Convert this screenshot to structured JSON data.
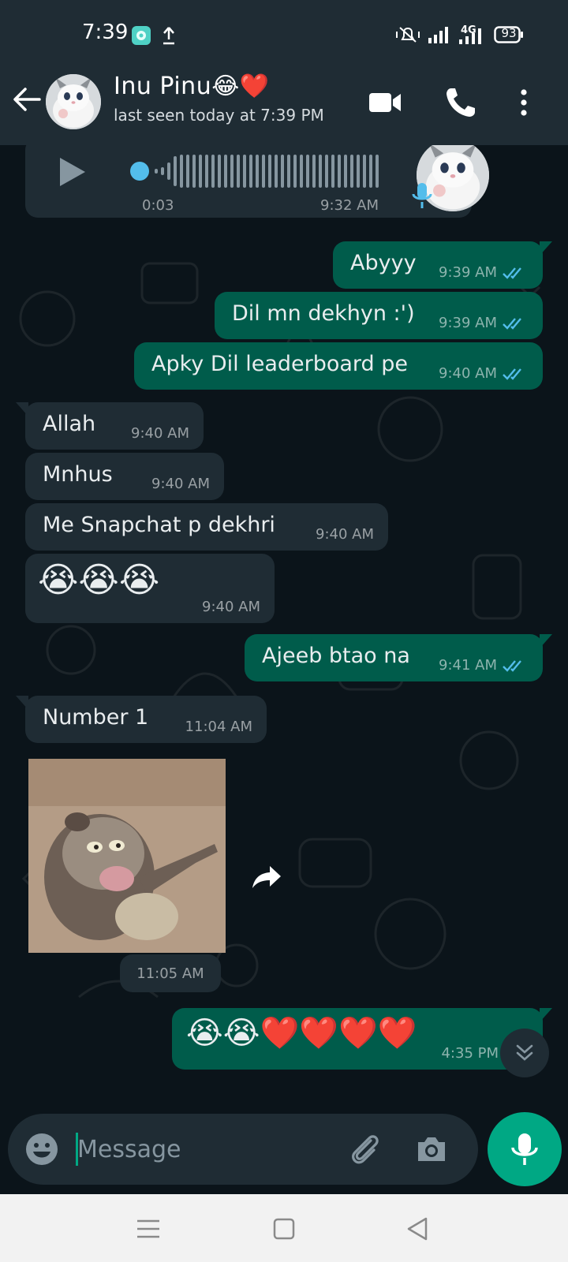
{
  "status_bar": {
    "time": "7:39",
    "battery": "93",
    "network": "4G",
    "icons": [
      "app-notification-icon",
      "upload-icon",
      "mute-icon",
      "signal-icon",
      "4g-signal-icon",
      "battery-icon"
    ]
  },
  "header": {
    "contact_name": "Inu Pinu😂❤️",
    "last_seen": "last seen today at 7:39 PM",
    "icons": [
      "back-arrow-icon",
      "video-call-icon",
      "phone-call-icon",
      "more-options-icon"
    ]
  },
  "messages": [
    {
      "type": "voice",
      "direction": "in",
      "duration": "0:03",
      "time": "9:32 AM"
    },
    {
      "type": "text",
      "direction": "out",
      "text": "Abyyy",
      "time": "9:39 AM",
      "status": "read"
    },
    {
      "type": "text",
      "direction": "out",
      "text": "Dil mn dekhyn :')",
      "time": "9:39 AM",
      "status": "read"
    },
    {
      "type": "text",
      "direction": "out",
      "text": "Apky Dil leaderboard pe",
      "time": "9:40 AM",
      "status": "read"
    },
    {
      "type": "text",
      "direction": "in",
      "text": "Allah",
      "time": "9:40 AM"
    },
    {
      "type": "text",
      "direction": "in",
      "text": "Mnhus",
      "time": "9:40 AM"
    },
    {
      "type": "text",
      "direction": "in",
      "text": "Me Snapchat p dekhri",
      "time": "9:40 AM"
    },
    {
      "type": "emoji",
      "direction": "in",
      "text": "😭😭😭",
      "time": "9:40 AM"
    },
    {
      "type": "text",
      "direction": "out",
      "text": "Ajeeb btao na",
      "time": "9:41 AM",
      "status": "read"
    },
    {
      "type": "text",
      "direction": "in",
      "text": "Number 1",
      "time": "11:04 AM"
    },
    {
      "type": "sticker",
      "direction": "in",
      "time": "11:05 AM"
    },
    {
      "type": "emoji",
      "direction": "out",
      "text": "😭😭❤️❤️❤️❤️",
      "time": "4:35 PM"
    }
  ],
  "composer": {
    "placeholder": "Message",
    "icons": [
      "emoji-icon",
      "attach-icon",
      "camera-icon",
      "mic-icon"
    ]
  },
  "nav_bar": {
    "icons": [
      "menu-icon",
      "home-icon",
      "back-icon"
    ]
  },
  "colors": {
    "background": "#0b141a",
    "header": "#1f2c34",
    "incoming_bubble": "#1f2c34",
    "outgoing_bubble": "#005c4b",
    "accent": "#00a884",
    "read_ticks": "#53bdeb"
  }
}
